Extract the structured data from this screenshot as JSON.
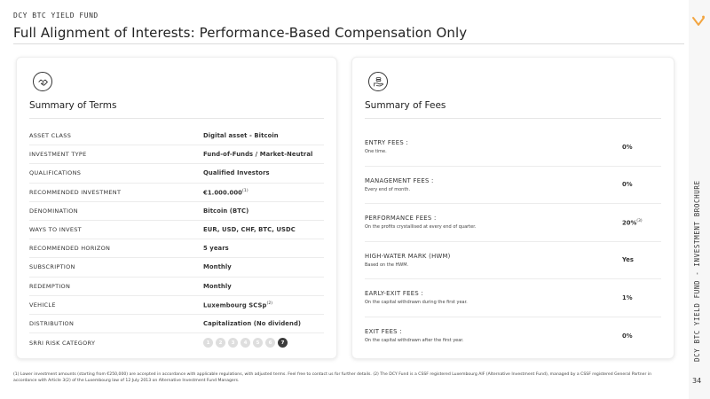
{
  "header": {
    "fund_tag": "DCY BTC YIELD FUND",
    "title": "Full Alignment of Interests: Performance-Based Compensation Only"
  },
  "sidebar": {
    "vertical_label": "DCY BTC YIELD FUND - INVESTMENT BROCHURE",
    "page_number": "34"
  },
  "terms_card": {
    "icon": "handshake-icon",
    "title": "Summary of Terms",
    "rows": [
      {
        "label": "ASSET CLASS",
        "value": "Digital asset - Bitcoin",
        "note": ""
      },
      {
        "label": "INVESTMENT TYPE",
        "value": "Fund-of-Funds / Market-Neutral",
        "note": ""
      },
      {
        "label": "QUALIFICATIONS",
        "value": "Qualified Investors",
        "note": ""
      },
      {
        "label": "RECOMMENDED INVESTMENT",
        "value": "€1.000.000",
        "note": "(1)"
      },
      {
        "label": "DENOMINATION",
        "value": "Bitcoin (BTC)",
        "note": ""
      },
      {
        "label": "WAYS TO INVEST",
        "value": "EUR, USD, CHF, BTC, USDC",
        "note": ""
      },
      {
        "label": "RECOMMENDED HORIZON",
        "value": "5 years",
        "note": ""
      },
      {
        "label": "SUBSCRIPTION",
        "value": "Monthly",
        "note": ""
      },
      {
        "label": "REDEMPTION",
        "value": "Monthly",
        "note": ""
      },
      {
        "label": "VEHICLE",
        "value": "Luxembourg SCSp",
        "note": "(2)"
      },
      {
        "label": "DISTRIBUTION",
        "value": "Capitalization (No dividend)",
        "note": ""
      }
    ],
    "risk": {
      "label": "SRRI RISK CATEGORY",
      "levels": [
        "1",
        "2",
        "3",
        "4",
        "5",
        "6",
        "7"
      ],
      "selected": 7
    }
  },
  "fees_card": {
    "icon": "coins-hand-icon",
    "title": "Summary of Fees",
    "rows": [
      {
        "label": "ENTRY FEES :",
        "desc": "One time.",
        "value": "0%",
        "note": ""
      },
      {
        "label": "MANAGEMENT FEES :",
        "desc": "Every end of month.",
        "value": "0%",
        "note": ""
      },
      {
        "label": "PERFORMANCE FEES :",
        "desc": "On the profits crystallised at every end of quarter.",
        "value": "20%",
        "note": "(3)"
      },
      {
        "label": "HIGH-WATER MARK (HWM)",
        "desc": "Based on the HWM.",
        "value": "Yes",
        "note": ""
      },
      {
        "label": "EARLY-EXIT FEES :",
        "desc": "On the capital withdrawn during the first year.",
        "value": "1%",
        "note": ""
      },
      {
        "label": "EXIT FEES :",
        "desc": "On the capital withdrawn after the first year.",
        "value": "0%",
        "note": ""
      }
    ]
  },
  "footnote": "(1) Lower investment amounts (starting from €250,000) are accepted in accordance with applicable regulations, with adjusted terms. Feel free to contact us for further details. (2) The DCY Fund is a CSSF registered Luxembourg AIF (Alternative Investment Fund), managed by a CSSF registered General Partner in accordance with Article 3(2) of the Luxembourg law of 12 July 2013 on Alternative Investment Fund Managers.",
  "colors": {
    "accent": "#f2a541",
    "text": "#2b2b2b",
    "risk_active": "#3b3b3b",
    "risk_inactive": "#dedede"
  }
}
